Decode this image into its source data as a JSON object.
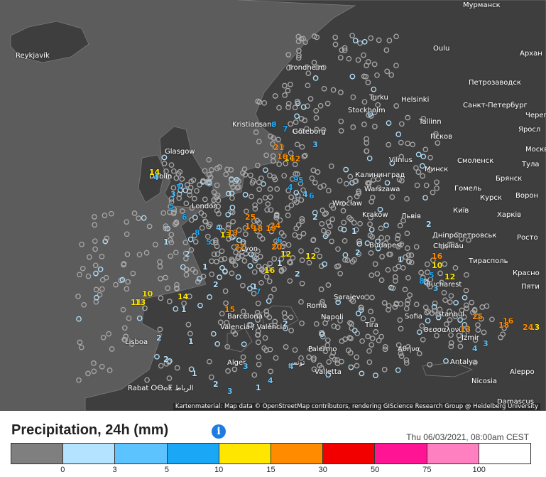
{
  "legend": {
    "title": "Precipitation, 24h (mm)",
    "timestamp": "Thu 06/03/2021, 08:00am CEST",
    "info_icon": "info-icon",
    "colors": [
      "#7f7f7f",
      "#b4e3ff",
      "#5cc3ff",
      "#1aa7f5",
      "#ffe600",
      "#ff8c00",
      "#f20000",
      "#ff1493",
      "#ff80c0",
      "#ffffff"
    ],
    "ticks": [
      "0",
      "3",
      "5",
      "10",
      "15",
      "30",
      "50",
      "75",
      "100"
    ]
  },
  "attribution": "Kartenmaterial: Map data © OpenStreetMap contributors, rendering GIScience Research Group @ Heidelberg University",
  "cities": [
    {
      "name": "Reykjavík"
    },
    {
      "name": "Oulu"
    },
    {
      "name": "Мурманск"
    },
    {
      "name": "Архан"
    },
    {
      "name": "Петрозаводск"
    },
    {
      "name": "Turku"
    },
    {
      "name": "Helsinki"
    },
    {
      "name": "Санкт-Петербург"
    },
    {
      "name": "Tallinn"
    },
    {
      "name": "Псков"
    },
    {
      "name": "Черепо"
    },
    {
      "name": "Яросл"
    },
    {
      "name": "Москва"
    },
    {
      "name": "Смоленск"
    },
    {
      "name": "Тула"
    },
    {
      "name": "Брянск"
    },
    {
      "name": "Vilnius"
    },
    {
      "name": "Минск"
    },
    {
      "name": "Калининград"
    },
    {
      "name": "Гомель"
    },
    {
      "name": "Курск"
    },
    {
      "name": "Ворон"
    },
    {
      "name": "Warszawa"
    },
    {
      "name": "Wrocław"
    },
    {
      "name": "Kraków"
    },
    {
      "name": "Львів"
    },
    {
      "name": "Київ"
    },
    {
      "name": "Харків"
    },
    {
      "name": "Дніпропетровськ"
    },
    {
      "name": "Росто"
    },
    {
      "name": "Chișinău"
    },
    {
      "name": "Тирасполь"
    },
    {
      "name": "Красно"
    },
    {
      "name": "Пяти"
    },
    {
      "name": "Roma"
    },
    {
      "name": "Napoli"
    },
    {
      "name": "Tira"
    },
    {
      "name": "Istanbul"
    },
    {
      "name": "Θεσσαλονίκη"
    },
    {
      "name": "Αθήνα"
    },
    {
      "name": "Palermo"
    },
    {
      "name": "Valletta"
    },
    {
      "name": "Antalya"
    },
    {
      "name": "Nicosia"
    },
    {
      "name": "Lisboa"
    },
    {
      "name": "Valencia / València"
    },
    {
      "name": "Alger"
    },
    {
      "name": "تونس"
    },
    {
      "name": "Rabat ⵔⴱⴰⵟ الرباط"
    },
    {
      "name": "Dublin"
    },
    {
      "name": "Kristiansand"
    },
    {
      "name": "Trondheim"
    },
    {
      "name": "Stockholm"
    },
    {
      "name": "Göteborg"
    },
    {
      "name": "Budapest"
    },
    {
      "name": "Sofia"
    },
    {
      "name": "Glasgow"
    },
    {
      "name": "London"
    },
    {
      "name": "Barcelona"
    },
    {
      "name": "Bucharest"
    },
    {
      "name": "Sarajevo"
    },
    {
      "name": "Lyon"
    },
    {
      "name": "Izmir"
    },
    {
      "name": "Damascus"
    },
    {
      "name": "Aleppo"
    }
  ],
  "stations": [
    {
      "value": "10",
      "level": 4
    },
    {
      "value": "11",
      "level": 4
    },
    {
      "value": "13",
      "level": 4
    },
    {
      "value": "14",
      "level": 4
    },
    {
      "value": "14",
      "level": 4
    },
    {
      "value": "12",
      "level": 4
    },
    {
      "value": "13",
      "level": 4
    },
    {
      "value": "12",
      "level": 4
    },
    {
      "value": "16",
      "level": 4
    },
    {
      "value": "10",
      "level": 4
    },
    {
      "value": "12",
      "level": 4
    },
    {
      "value": "13",
      "level": 4
    },
    {
      "value": "14",
      "level": 4
    },
    {
      "value": "21",
      "level": 5
    },
    {
      "value": "16",
      "level": 5
    },
    {
      "value": "12",
      "level": 5
    },
    {
      "value": "25",
      "level": 5
    },
    {
      "value": "22",
      "level": 5
    },
    {
      "value": "16",
      "level": 5
    },
    {
      "value": "20",
      "level": 5
    },
    {
      "value": "18",
      "level": 5
    },
    {
      "value": "19",
      "level": 5
    },
    {
      "value": "15",
      "level": 5
    },
    {
      "value": "24",
      "level": 5
    },
    {
      "value": "16",
      "level": 5
    },
    {
      "value": "25",
      "level": 5
    },
    {
      "value": "13",
      "level": 5
    },
    {
      "value": "16",
      "level": 5
    },
    {
      "value": "18",
      "level": 5
    },
    {
      "value": "24",
      "level": 5
    },
    {
      "value": "13",
      "level": 5
    },
    {
      "value": "4",
      "level": 3
    },
    {
      "value": "9",
      "level": 3
    },
    {
      "value": "5",
      "level": 3
    },
    {
      "value": "6",
      "level": 3
    },
    {
      "value": "7",
      "level": 3
    },
    {
      "value": "5",
      "level": 3
    },
    {
      "value": "6",
      "level": 3
    },
    {
      "value": "8",
      "level": 3
    },
    {
      "value": "5",
      "level": 3
    },
    {
      "value": "9",
      "level": 3
    },
    {
      "value": "7",
      "level": 3
    },
    {
      "value": "6",
      "level": 3
    },
    {
      "value": "5",
      "level": 3
    },
    {
      "value": "8",
      "level": 3
    },
    {
      "value": "7",
      "level": 3
    },
    {
      "value": "4",
      "level": 2
    },
    {
      "value": "3",
      "level": 2
    },
    {
      "value": "4",
      "level": 2
    },
    {
      "value": "3",
      "level": 2
    },
    {
      "value": "4",
      "level": 2
    },
    {
      "value": "3",
      "level": 2
    },
    {
      "value": "4",
      "level": 2
    },
    {
      "value": "3",
      "level": 2
    },
    {
      "value": "4",
      "level": 2
    },
    {
      "value": "3",
      "level": 2
    },
    {
      "value": "4",
      "level": 2
    },
    {
      "value": "3",
      "level": 2
    },
    {
      "value": "1",
      "level": 1
    },
    {
      "value": "2",
      "level": 1
    },
    {
      "value": "1",
      "level": 1
    },
    {
      "value": "2",
      "level": 1
    },
    {
      "value": "1",
      "level": 1
    },
    {
      "value": "2",
      "level": 1
    },
    {
      "value": "1",
      "level": 1
    },
    {
      "value": "2",
      "level": 1
    },
    {
      "value": "1",
      "level": 1
    },
    {
      "value": "2",
      "level": 1
    },
    {
      "value": "1",
      "level": 1
    },
    {
      "value": "2",
      "level": 1
    },
    {
      "value": "1",
      "level": 1
    },
    {
      "value": "2",
      "level": 1
    },
    {
      "value": "1",
      "level": 1
    },
    {
      "value": "2",
      "level": 1
    },
    {
      "value": "1",
      "level": 1
    },
    {
      "value": "2",
      "level": 1
    },
    {
      "value": "1",
      "level": 1
    },
    {
      "value": "2",
      "level": 1
    }
  ]
}
